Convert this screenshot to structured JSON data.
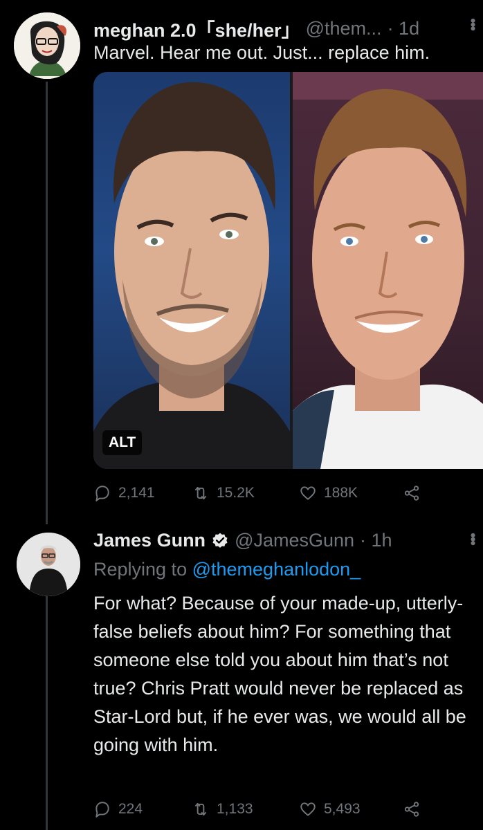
{
  "tweet1": {
    "name": "meghan 2.0「she/her」",
    "handle": "@them...",
    "time": "· 1d",
    "text": "Marvel. Hear me out. Just... replace him.",
    "alt_label": "ALT",
    "stats": {
      "replies": "2,141",
      "retweets": "15.2K",
      "likes": "188K"
    }
  },
  "tweet2": {
    "name": "James Gunn",
    "handle": "@JamesGunn",
    "time": "· 1h",
    "reply_prefix": "Replying to",
    "reply_handle": "@themeghanlodon_",
    "text": "For what? Because of your made-up, utterly-false beliefs about him? For something that someone else told you about him that’s not true? Chris Pratt would never be replaced as Star-Lord but, if he ever was, we would all be going with him.",
    "stats": {
      "replies": "224",
      "retweets": "1,133",
      "likes": "5,493"
    }
  },
  "colors": {
    "background": "#000000",
    "text": "#e7e9ea",
    "muted": "#71767b",
    "link": "#1d9bf0",
    "verified": "#e7e9ea"
  },
  "icons": [
    "reply-icon",
    "retweet-icon",
    "like-icon",
    "share-icon",
    "more-icon",
    "verified-icon"
  ]
}
